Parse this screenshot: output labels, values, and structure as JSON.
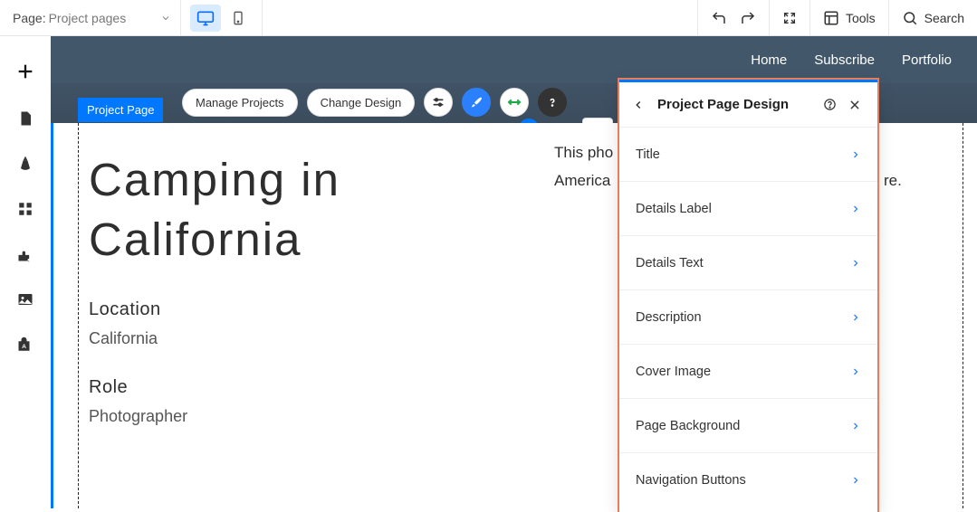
{
  "toolbar": {
    "page_label": "Page:",
    "page_value": "Project pages",
    "tools_label": "Tools",
    "search_label": "Search"
  },
  "nav": {
    "home": "Home",
    "subscribe": "Subscribe",
    "portfolio": "Portfolio"
  },
  "section": {
    "label": "Project Page",
    "manage_projects": "Manage Projects",
    "change_design": "Change Design"
  },
  "project": {
    "title_line1": "Camping in",
    "title_line2": "California",
    "desc_line1": "This pho",
    "desc_line2": "America",
    "desc_tail": "re.",
    "location_label": "Location",
    "location_value": "California",
    "role_label": "Role",
    "role_value": "Photographer"
  },
  "panel": {
    "title": "Project Page Design",
    "items": [
      "Title",
      "Details Label",
      "Details Text",
      "Description",
      "Cover Image",
      "Page Background",
      "Navigation Buttons"
    ]
  }
}
